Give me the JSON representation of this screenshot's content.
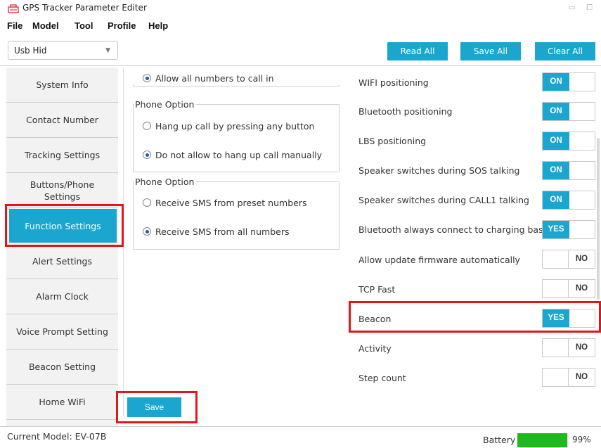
{
  "window": {
    "title": "GPS Tracker Parameter Editer"
  },
  "menu": [
    "File",
    "Model",
    "Tool",
    "Profile",
    "Help"
  ],
  "toolbar": {
    "port_value": "Usb Hid",
    "read_all": "Read All",
    "save_all": "Save All",
    "clear_all": "Clear All"
  },
  "sidebar": {
    "items": [
      "System Info",
      "Contact Number",
      "Tracking Settings",
      "Buttons/Phone Settings",
      "Function Settings",
      "Alert Settings",
      "Alarm Clock",
      "Voice Prompt Setting",
      "Beacon Setting",
      "Home WiFi"
    ],
    "active_index": 4
  },
  "call_in": {
    "label": "Allow all numbers to call in",
    "checked": true
  },
  "groups": [
    {
      "title": "Phone Option",
      "options": [
        {
          "label": "Hang up call by pressing any button",
          "checked": false
        },
        {
          "label": "Do not allow to hang up call manually",
          "checked": true
        }
      ]
    },
    {
      "title": "Phone Option",
      "options": [
        {
          "label": "Receive SMS from preset numbers",
          "checked": false
        },
        {
          "label": "Receive SMS from all numbers",
          "checked": true
        }
      ]
    }
  ],
  "settings": [
    {
      "label": "WIFI positioning",
      "state": "on",
      "value": "ON"
    },
    {
      "label": "Bluetooth positioning",
      "state": "on",
      "value": "ON"
    },
    {
      "label": "LBS positioning",
      "state": "on",
      "value": "ON"
    },
    {
      "label": "Speaker switches during SOS talking",
      "state": "on",
      "value": "ON"
    },
    {
      "label": "Speaker switches during CALL1 talking",
      "state": "on",
      "value": "ON"
    },
    {
      "label": "Bluetooth always connect to charging base",
      "state": "on",
      "value": "YES"
    },
    {
      "label": "Allow update firmware automatically",
      "state": "off",
      "value": "NO"
    },
    {
      "label": "TCP Fast",
      "state": "off",
      "value": "NO"
    },
    {
      "label": "Beacon",
      "state": "on",
      "value": "YES"
    },
    {
      "label": "Activity",
      "state": "off",
      "value": "NO"
    },
    {
      "label": "Step count",
      "state": "off",
      "value": "NO"
    }
  ],
  "save_label": "Save",
  "status": {
    "model": "Current Model: EV-07B",
    "battery_label": "Battery",
    "battery_percent": 99,
    "battery_text": "99%"
  },
  "colors": {
    "accent": "#1aa6cf",
    "highlight": "#e0161b",
    "battery": "#1fb81f"
  }
}
